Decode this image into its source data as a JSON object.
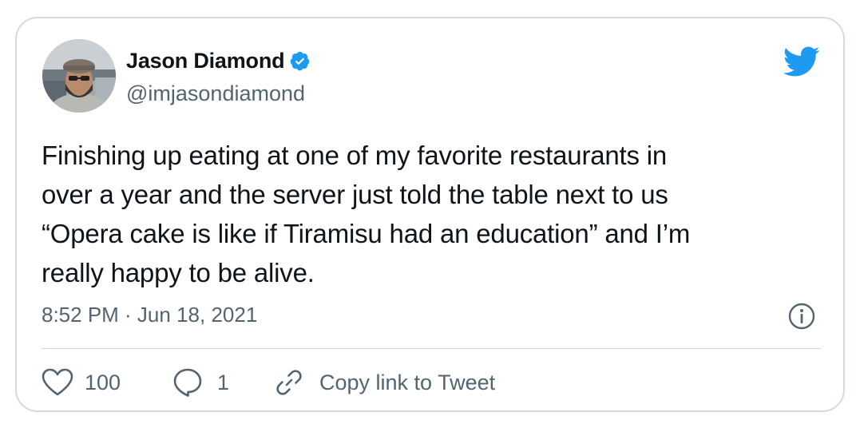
{
  "user": {
    "display_name": "Jason Diamond",
    "handle": "@imjasondiamond",
    "verified": true,
    "avatar_icon": "user-avatar-photo"
  },
  "tweet": {
    "text": "Finishing up eating at one of my favorite restaurants in\nover a year and the server just told the table next to us\n“Opera cake is like if Tiramisu had an education” and I’m\nreally happy to be alive.",
    "timestamp": "8:52 PM · Jun 18, 2021"
  },
  "actions": {
    "like_count": "100",
    "reply_count": "1",
    "copy_link_label": "Copy link to Tweet"
  },
  "icons": {
    "brand": "twitter-bird-icon",
    "verified": "verified-badge-icon",
    "info": "info-icon",
    "like": "heart-icon",
    "reply": "reply-bubble-icon",
    "copy_link": "link-icon"
  },
  "colors": {
    "brand_blue": "#1d9bf0",
    "text_primary": "#0f1419",
    "text_secondary": "#536471",
    "border": "#d4dadf"
  }
}
